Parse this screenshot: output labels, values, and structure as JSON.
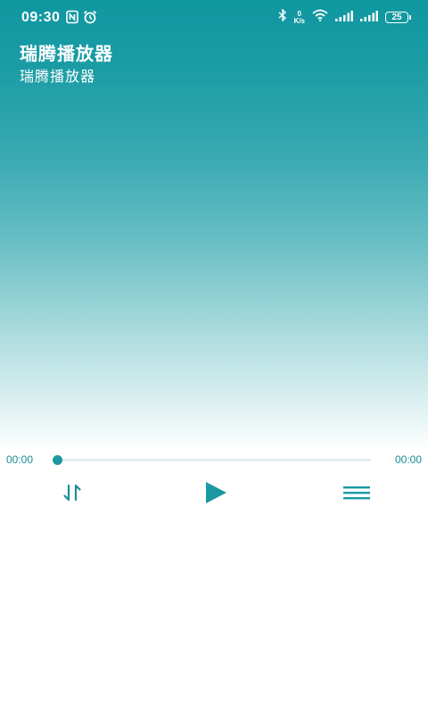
{
  "status_bar": {
    "time": "09:30",
    "net_speed_value": "0",
    "net_speed_unit": "K/s",
    "battery": "25"
  },
  "header": {
    "title": "瑞腾播放器",
    "subtitle": "瑞腾播放器"
  },
  "player": {
    "current_time": "00:00",
    "total_time": "00:00",
    "progress": 0
  },
  "colors": {
    "accent": "#1a99a2",
    "hero_top": "#0f97a0"
  },
  "icons": {
    "mode": "repeat-order-icon",
    "play": "play-icon",
    "list": "playlist-icon"
  }
}
